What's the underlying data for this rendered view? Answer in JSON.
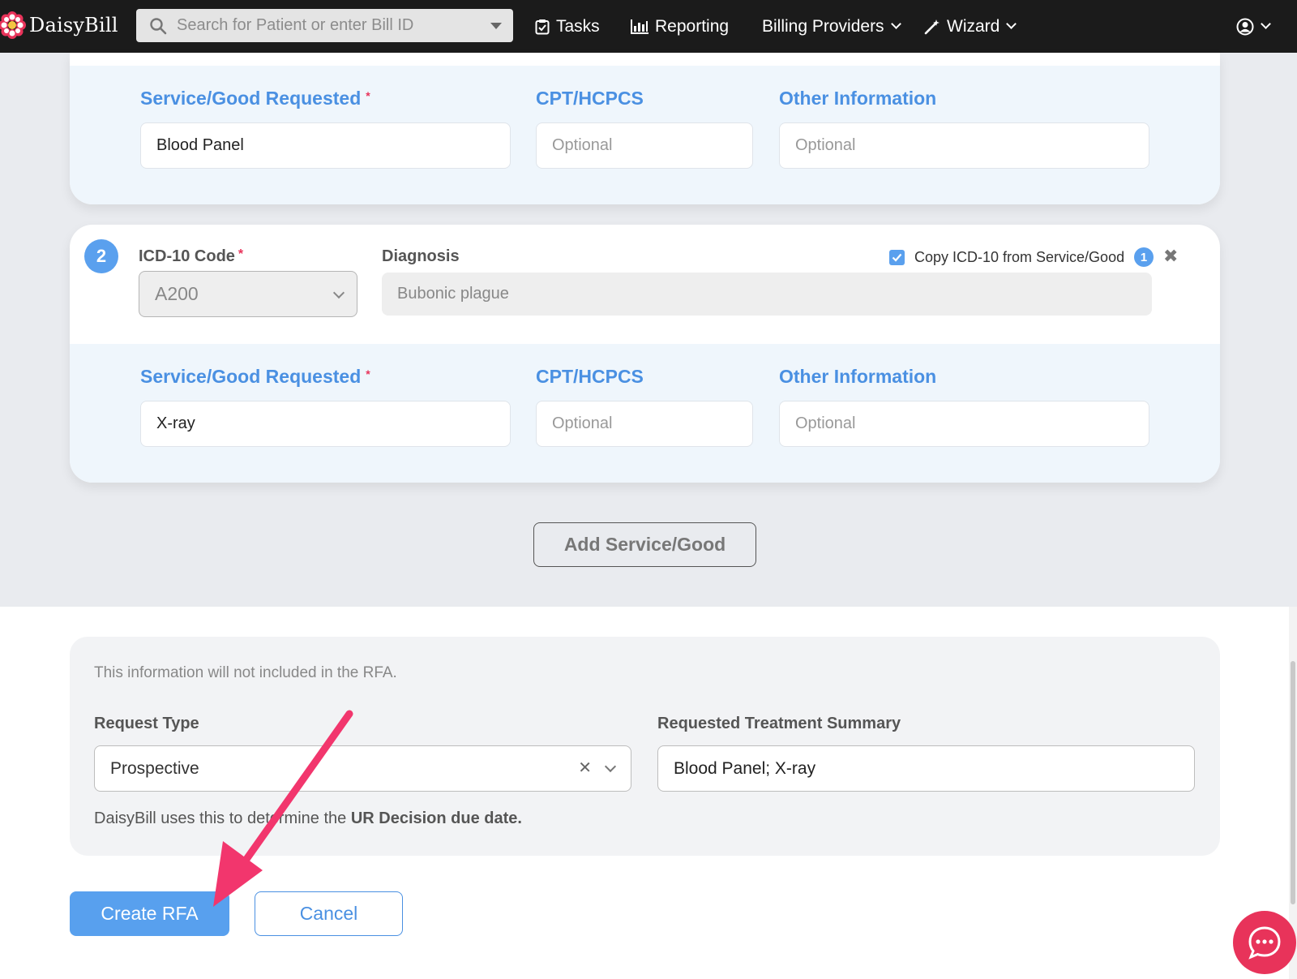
{
  "nav": {
    "brand": "DaisyBill",
    "search_placeholder": "Search for Patient or enter Bill ID",
    "tasks": "Tasks",
    "reporting": "Reporting",
    "billing_providers": "Billing Providers",
    "wizard": "Wizard"
  },
  "entries": [
    {
      "service_label": "Service/Good Requested",
      "cpt_label": "CPT/HCPCS",
      "other_label": "Other Information",
      "service_value": "Blood Panel",
      "cpt_placeholder": "Optional",
      "other_placeholder": "Optional"
    },
    {
      "number": "2",
      "icd_label": "ICD-10 Code",
      "icd_value": "A200",
      "diagnosis_label": "Diagnosis",
      "diagnosis_value": "Bubonic plague",
      "copy_label": "Copy ICD-10 from Service/Good",
      "copy_ref": "1",
      "copy_checked": true,
      "service_label": "Service/Good Requested",
      "cpt_label": "CPT/HCPCS",
      "other_label": "Other Information",
      "service_value": "X-ray",
      "cpt_placeholder": "Optional",
      "other_placeholder": "Optional"
    }
  ],
  "add_service_label": "Add Service/Good",
  "info": {
    "note": "This information will not included in the RFA.",
    "request_type_label": "Request Type",
    "request_type_value": "Prospective",
    "summary_label": "Requested Treatment Summary",
    "summary_value": "Blood Panel; X-ray",
    "help_prefix": "DaisyBill uses this to determine the ",
    "help_bold": "UR Decision due date."
  },
  "actions": {
    "create": "Create RFA",
    "cancel": "Cancel"
  },
  "colors": {
    "accent": "#4a90e2",
    "required": "#e8335a",
    "annotation_arrow": "#f2366d",
    "nav_bg": "#1b1b1b"
  }
}
